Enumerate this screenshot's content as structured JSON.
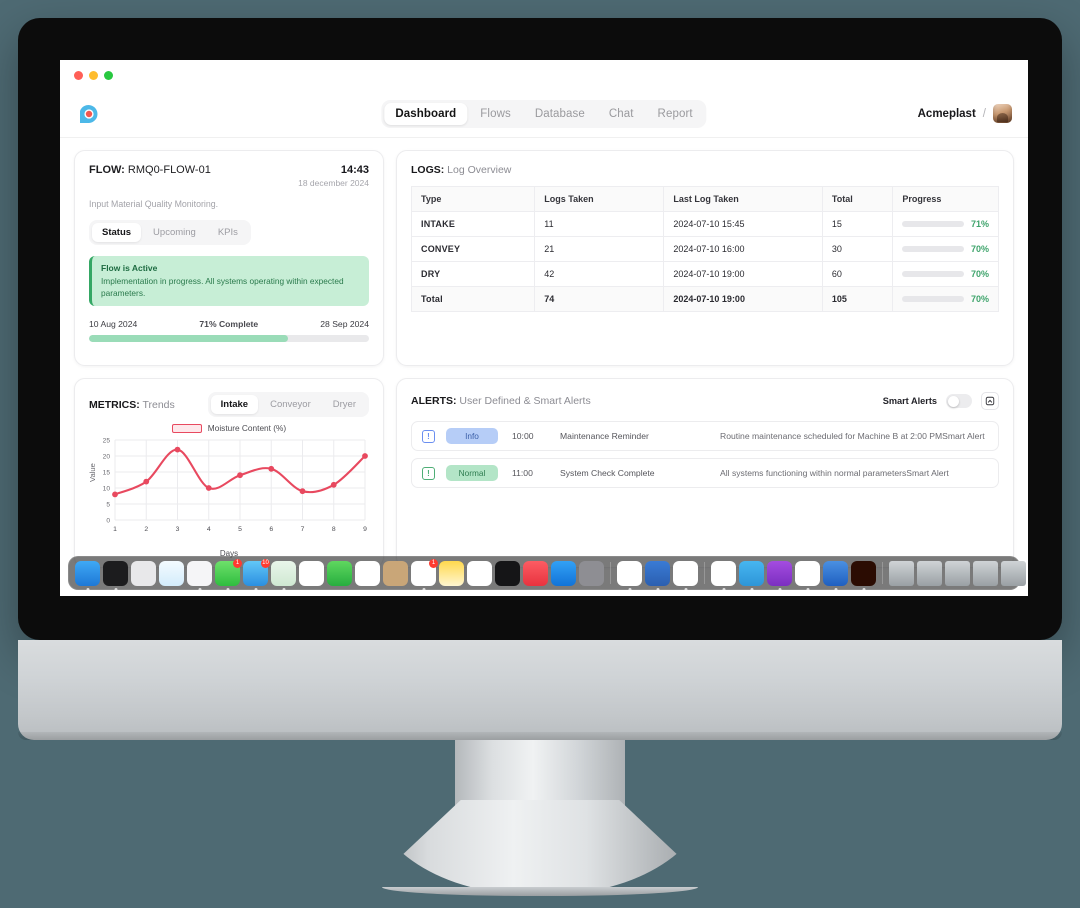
{
  "window": {
    "traffic_lights": [
      "close",
      "minimize",
      "zoom"
    ]
  },
  "topnav": {
    "logo_icon": "app-logo-icon",
    "items": [
      {
        "label": "Dashboard",
        "active": true
      },
      {
        "label": "Flows",
        "active": false
      },
      {
        "label": "Database",
        "active": false
      },
      {
        "label": "Chat",
        "active": false
      },
      {
        "label": "Report",
        "active": false
      }
    ],
    "org": "Acmeplast",
    "separator": "/",
    "avatar_icon": "user-avatar"
  },
  "flow_card": {
    "label": "FLOW:",
    "id": "RMQ0-FLOW-01",
    "time": "14:43",
    "date": "18 december 2024",
    "subtitle": "Input Material Quality Monitoring.",
    "tabs": [
      {
        "label": "Status",
        "active": true
      },
      {
        "label": "Upcoming",
        "active": false
      },
      {
        "label": "KPIs",
        "active": false
      }
    ],
    "banner": {
      "title": "Flow is Active",
      "description": "Implementation in progress. All systems operating within expected parameters."
    },
    "timeline": {
      "start": "10 Aug 2024",
      "middle": "71% Complete",
      "end": "28 Sep 2024",
      "percent": 71
    }
  },
  "logs_card": {
    "label": "LOGS:",
    "title": "Log Overview",
    "columns": [
      "Type",
      "Logs Taken",
      "Last Log Taken",
      "Total",
      "Progress"
    ],
    "rows": [
      {
        "type": "INTAKE",
        "logs_taken": "11",
        "last_log": "2024-07-10 15:45",
        "total": "15",
        "progress": 71,
        "progress_label": "71%",
        "is_total": false
      },
      {
        "type": "CONVEY",
        "logs_taken": "21",
        "last_log": "2024-07-10 16:00",
        "total": "30",
        "progress": 70,
        "progress_label": "70%",
        "is_total": false
      },
      {
        "type": "DRY",
        "logs_taken": "42",
        "last_log": "2024-07-10 19:00",
        "total": "60",
        "progress": 70,
        "progress_label": "70%",
        "is_total": false
      },
      {
        "type": "Total",
        "logs_taken": "74",
        "last_log": "2024-07-10 19:00",
        "total": "105",
        "progress": 70,
        "progress_label": "70%",
        "is_total": true
      }
    ]
  },
  "metrics_card": {
    "label": "METRICS:",
    "title": "Trends",
    "tabs": [
      {
        "label": "Intake",
        "active": true
      },
      {
        "label": "Conveyor",
        "active": false
      },
      {
        "label": "Dryer",
        "active": false
      }
    ]
  },
  "alerts_card": {
    "label": "ALERTS:",
    "title": "User Defined & Smart Alerts",
    "smart_alerts_label": "Smart Alerts",
    "smart_alerts_on": false,
    "expand_icon": "expand-icon",
    "rows": [
      {
        "icon": "alert-info-icon",
        "severity": "Info",
        "severity_kind": "info",
        "time": "10:00",
        "title": "Maintenance Reminder",
        "description": "Routine maintenance scheduled for Machine B at 2:00 PMSmart Alert"
      },
      {
        "icon": "alert-normal-icon",
        "severity": "Normal",
        "severity_kind": "normal",
        "time": "11:00",
        "title": "System Check Complete",
        "description": "All systems functioning within normal parametersSmart Alert"
      }
    ]
  },
  "chart_data": {
    "type": "line",
    "title": "",
    "legend": [
      "Moisture Content (%)"
    ],
    "legend_position": "top-center",
    "series": [
      {
        "name": "Moisture Content (%)",
        "values": [
          8,
          12,
          22,
          10,
          14,
          16,
          9,
          11,
          20
        ],
        "color": "#e8495f"
      }
    ],
    "x": [
      1,
      2,
      3,
      4,
      5,
      6,
      7,
      8,
      9
    ],
    "categories": [
      "1",
      "2",
      "3",
      "4",
      "5",
      "6",
      "7",
      "8",
      "9"
    ],
    "xlabel": "Days",
    "ylabel": "Value",
    "ylim": [
      0,
      25
    ],
    "yticks": [
      0,
      5,
      10,
      15,
      20,
      25
    ],
    "xlim": [
      1,
      9
    ],
    "grid": true
  },
  "colors": {
    "accent_pink": "#e8495f",
    "accent_green": "#3fa46c",
    "progress_fill": "#a9e3c2",
    "banner_bg": "#c7eed6",
    "desktop_bg": "#4e6a73"
  },
  "dock": {
    "apps": [
      {
        "name": "finder",
        "color": "linear-gradient(180deg,#3fa9f5,#1e78d6)",
        "badge": "",
        "running": true
      },
      {
        "name": "terminal",
        "color": "#1c1c1e",
        "badge": "",
        "running": true
      },
      {
        "name": "launchpad",
        "color": "#e8e8ea",
        "badge": "",
        "running": false
      },
      {
        "name": "safari",
        "color": "linear-gradient(180deg,#f4fbff,#d3ecfb)",
        "badge": "",
        "running": false
      },
      {
        "name": "chrome",
        "color": "#f5f5f7",
        "badge": "",
        "running": true
      },
      {
        "name": "messages",
        "color": "linear-gradient(180deg,#6ee06b,#2fbd3f)",
        "badge": "1",
        "running": true
      },
      {
        "name": "mail",
        "color": "linear-gradient(180deg,#62c7f7,#2b8fe0)",
        "badge": "10",
        "running": true
      },
      {
        "name": "maps",
        "color": "linear-gradient(180deg,#e9f6ea,#cfe8d2)",
        "badge": "",
        "running": true
      },
      {
        "name": "photos",
        "color": "#ffffff",
        "badge": "",
        "running": false
      },
      {
        "name": "facetime",
        "color": "linear-gradient(180deg,#5fd75f,#27ae3f)",
        "badge": "",
        "running": false
      },
      {
        "name": "calendar",
        "color": "#ffffff",
        "badge": "",
        "running": false
      },
      {
        "name": "contacts",
        "color": "#c9a678",
        "badge": "",
        "running": false
      },
      {
        "name": "reminders",
        "color": "#ffffff",
        "badge": "1",
        "running": true
      },
      {
        "name": "notes",
        "color": "linear-gradient(180deg,#ffd84d,#fff6d0)",
        "badge": "",
        "running": false
      },
      {
        "name": "stocks",
        "color": "#ffffff",
        "badge": "",
        "running": false
      },
      {
        "name": "appletv",
        "color": "#151517",
        "badge": "",
        "running": false
      },
      {
        "name": "music",
        "color": "linear-gradient(180deg,#fc5c63,#e8333f)",
        "badge": "",
        "running": false
      },
      {
        "name": "appstore",
        "color": "linear-gradient(180deg,#32a1f5,#1273d8)",
        "badge": "",
        "running": false
      },
      {
        "name": "settings",
        "color": "#8e8e93",
        "badge": "",
        "running": false
      },
      {
        "name": "vscode",
        "color": "#ffffff",
        "badge": "",
        "running": true
      },
      {
        "name": "xcode",
        "color": "linear-gradient(180deg,#3a7bd5,#2b5fb0)",
        "badge": "",
        "running": true
      },
      {
        "name": "spotify",
        "color": "#ffffff",
        "badge": "",
        "running": true
      },
      {
        "name": "slack",
        "color": "#ffffff",
        "badge": "",
        "running": true
      },
      {
        "name": "telegram",
        "color": "linear-gradient(180deg,#47b6f0,#2d95d8)",
        "badge": "",
        "running": true
      },
      {
        "name": "tor",
        "color": "linear-gradient(180deg,#a44ce0,#7b2fc0)",
        "badge": "",
        "running": true
      },
      {
        "name": "arc",
        "color": "#ffffff",
        "badge": "",
        "running": true
      },
      {
        "name": "wireshark",
        "color": "linear-gradient(180deg,#4a90e2,#1f5fc0)",
        "badge": "",
        "running": true
      },
      {
        "name": "illustrator",
        "color": "#2b0c02",
        "badge": "",
        "running": true
      }
    ],
    "minimized": [
      {
        "name": "window-code"
      },
      {
        "name": "window-display"
      },
      {
        "name": "window-browser"
      },
      {
        "name": "window-terminal"
      },
      {
        "name": "window-editor"
      }
    ],
    "trash": {
      "name": "trash"
    }
  }
}
